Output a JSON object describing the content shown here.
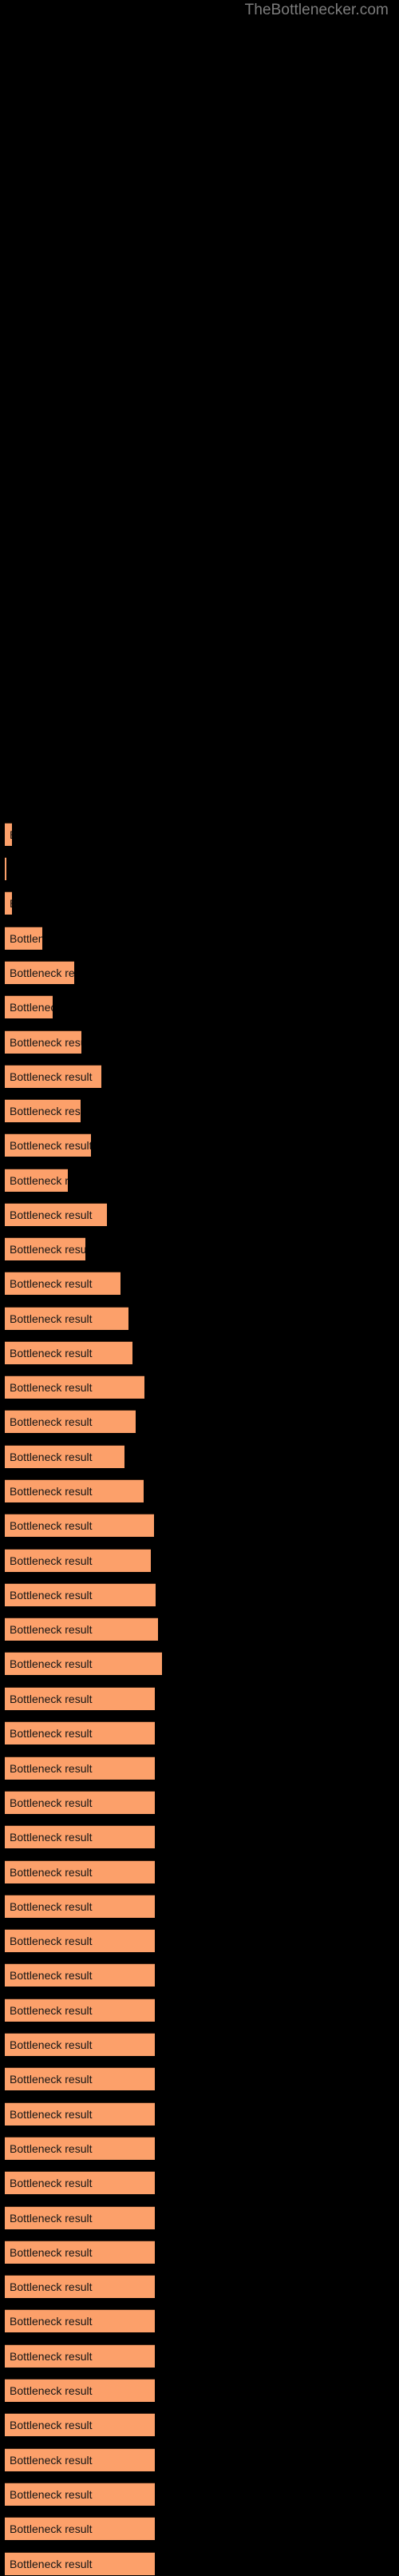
{
  "watermark": {
    "text": "TheBottlenecker.com",
    "color": "#7d7d7d"
  },
  "theme": {
    "background": "#000000",
    "bar_fill": "#fca06a",
    "bar_border_top": "#3d2414",
    "bar_label_color": "#141414"
  },
  "chart_data": {
    "type": "bar",
    "orientation": "horizontal",
    "title": "",
    "subtitle": "",
    "xlabel": "",
    "ylabel": "",
    "grid": false,
    "legend": null,
    "axis_visible": false,
    "tick_labels": [],
    "bar_label_text": "Bottleneck result",
    "xlim": [
      0,
      500
    ],
    "categories": [
      "bar-1",
      "bar-2",
      "bar-3",
      "bar-4",
      "bar-5",
      "bar-6",
      "bar-7",
      "bar-8",
      "bar-9",
      "bar-10",
      "bar-11",
      "bar-12",
      "bar-13",
      "bar-14",
      "bar-15",
      "bar-16",
      "bar-17",
      "bar-18",
      "bar-19",
      "bar-20",
      "bar-21",
      "bar-22",
      "bar-23",
      "bar-24",
      "bar-25",
      "bar-26"
    ],
    "values": [
      9,
      2,
      9,
      47,
      87,
      60,
      96,
      121,
      95,
      108,
      79,
      128,
      101,
      145,
      155,
      160,
      175,
      164,
      150,
      174,
      187,
      183,
      189,
      192,
      197,
      188
    ],
    "bars": [
      {
        "index": 1,
        "top": 1030,
        "width": 9,
        "label": "Bottleneck result"
      },
      {
        "index": 2,
        "top": 1073,
        "width": 2,
        "label": "Bottleneck result"
      },
      {
        "index": 3,
        "top": 1116,
        "width": 9,
        "label": "Bottleneck result"
      },
      {
        "index": 4,
        "top": 1160,
        "width": 47,
        "label": "Bottleneck result"
      },
      {
        "index": 5,
        "top": 1203,
        "width": 87,
        "label": "Bottleneck result"
      },
      {
        "index": 6,
        "top": 1246,
        "width": 60,
        "label": "Bottleneck result"
      },
      {
        "index": 7,
        "top": 1290,
        "width": 96,
        "label": "Bottleneck result"
      },
      {
        "index": 8,
        "top": 1333,
        "width": 121,
        "label": "Bottleneck result"
      },
      {
        "index": 9,
        "top": 1376,
        "width": 95,
        "label": "Bottleneck result"
      },
      {
        "index": 10,
        "top": 1419,
        "width": 108,
        "label": "Bottleneck result"
      },
      {
        "index": 11,
        "top": 1463,
        "width": 79,
        "label": "Bottleneck result"
      },
      {
        "index": 12,
        "top": 1506,
        "width": 128,
        "label": "Bottleneck result"
      },
      {
        "index": 13,
        "top": 1549,
        "width": 101,
        "label": "Bottleneck result"
      },
      {
        "index": 14,
        "top": 1592,
        "width": 145,
        "label": "Bottleneck result"
      },
      {
        "index": 15,
        "top": 1636,
        "width": 155,
        "label": "Bottleneck result"
      },
      {
        "index": 16,
        "top": 1679,
        "width": 160,
        "label": "Bottleneck result"
      },
      {
        "index": 17,
        "top": 1722,
        "width": 175,
        "label": "Bottleneck result"
      },
      {
        "index": 18,
        "top": 1765,
        "width": 164,
        "label": "Bottleneck result"
      },
      {
        "index": 19,
        "top": 1809,
        "width": 150,
        "label": "Bottleneck result"
      },
      {
        "index": 20,
        "top": 1852,
        "width": 174,
        "label": "Bottleneck result"
      },
      {
        "index": 21,
        "top": 1895,
        "width": 187,
        "label": "Bottleneck result"
      },
      {
        "index": 22,
        "top": 1939,
        "width": 183,
        "label": "Bottleneck result"
      },
      {
        "index": 23,
        "top": 1982,
        "width": 189,
        "label": "Bottleneck result"
      },
      {
        "index": 24,
        "top": 2025,
        "width": 192,
        "label": "Bottleneck result"
      },
      {
        "index": 25,
        "top": 2068,
        "width": 197,
        "label": "Bottleneck result"
      },
      {
        "index": 26,
        "top": 2112,
        "width": 188,
        "label": "Bottleneck result"
      }
    ]
  }
}
